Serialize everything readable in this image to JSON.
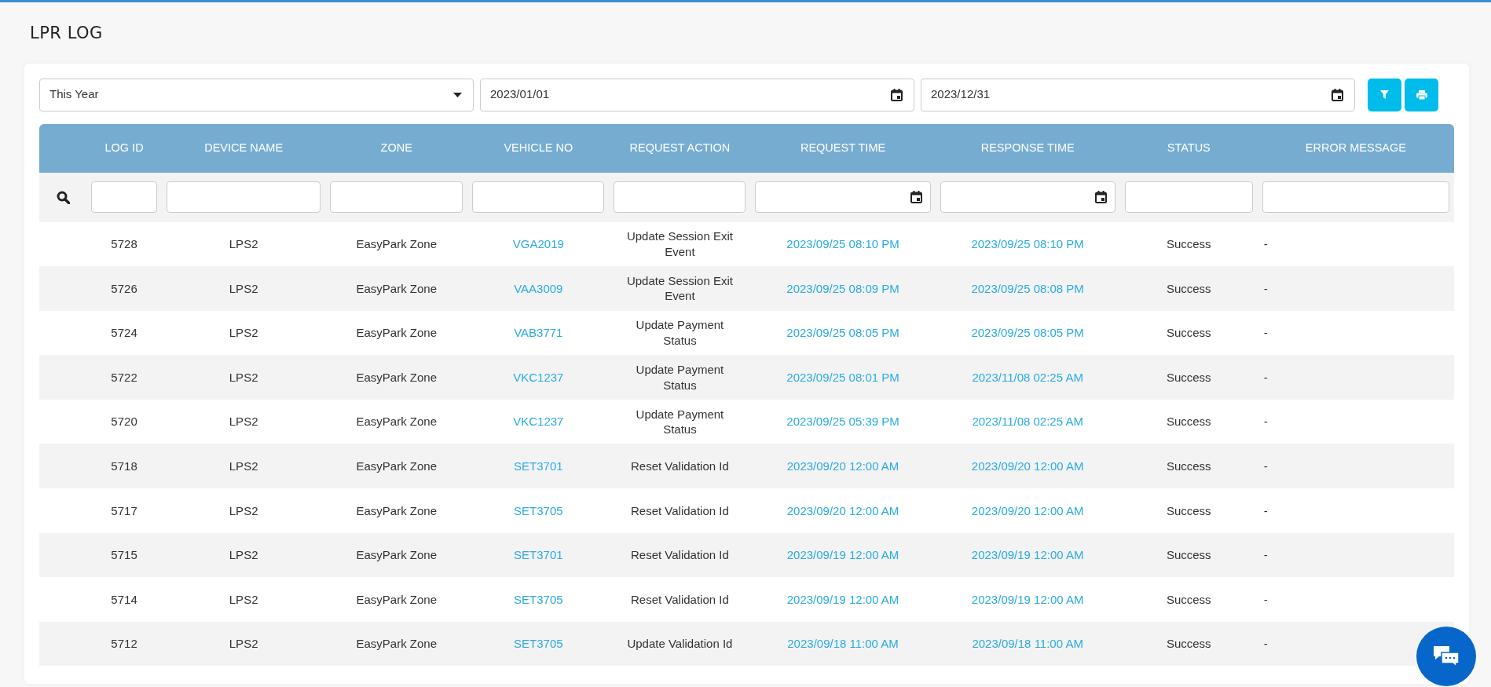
{
  "page_title": "LPR LOG",
  "filters": {
    "period": "This Year",
    "start_date": "2023/01/01",
    "end_date": "2023/12/31"
  },
  "table": {
    "columns": [
      "LOG ID",
      "DEVICE NAME",
      "ZONE",
      "VEHICLE NO",
      "REQUEST ACTION",
      "REQUEST TIME",
      "RESPONSE TIME",
      "STATUS",
      "ERROR MESSAGE"
    ],
    "filters": [
      {
        "kind": "text"
      },
      {
        "kind": "text"
      },
      {
        "kind": "text"
      },
      {
        "kind": "text"
      },
      {
        "kind": "text"
      },
      {
        "kind": "date"
      },
      {
        "kind": "date"
      },
      {
        "kind": "text"
      },
      {
        "kind": "text"
      }
    ],
    "rows": [
      {
        "log_id": "5728",
        "device": "LPS2",
        "zone": "EasyPark Zone",
        "vehicle": "VGA2019",
        "action": "Update Session Exit Event",
        "request_time": "2023/09/25 08:10 PM",
        "response_time": "2023/09/25 08:10 PM",
        "status": "Success",
        "error": "-"
      },
      {
        "log_id": "5726",
        "device": "LPS2",
        "zone": "EasyPark Zone",
        "vehicle": "VAA3009",
        "action": "Update Session Exit Event",
        "request_time": "2023/09/25 08:09 PM",
        "response_time": "2023/09/25 08:08 PM",
        "status": "Success",
        "error": "-"
      },
      {
        "log_id": "5724",
        "device": "LPS2",
        "zone": "EasyPark Zone",
        "vehicle": "VAB3771",
        "action": "Update Payment Status",
        "request_time": "2023/09/25 08:05 PM",
        "response_time": "2023/09/25 08:05 PM",
        "status": "Success",
        "error": "-"
      },
      {
        "log_id": "5722",
        "device": "LPS2",
        "zone": "EasyPark Zone",
        "vehicle": "VKC1237",
        "action": "Update Payment Status",
        "request_time": "2023/09/25 08:01 PM",
        "response_time": "2023/11/08 02:25 AM",
        "status": "Success",
        "error": "-"
      },
      {
        "log_id": "5720",
        "device": "LPS2",
        "zone": "EasyPark Zone",
        "vehicle": "VKC1237",
        "action": "Update Payment Status",
        "request_time": "2023/09/25 05:39 PM",
        "response_time": "2023/11/08 02:25 AM",
        "status": "Success",
        "error": "-"
      },
      {
        "log_id": "5718",
        "device": "LPS2",
        "zone": "EasyPark Zone",
        "vehicle": "SET3701",
        "action": "Reset Validation Id",
        "request_time": "2023/09/20 12:00 AM",
        "response_time": "2023/09/20 12:00 AM",
        "status": "Success",
        "error": "-"
      },
      {
        "log_id": "5717",
        "device": "LPS2",
        "zone": "EasyPark Zone",
        "vehicle": "SET3705",
        "action": "Reset Validation Id",
        "request_time": "2023/09/20 12:00 AM",
        "response_time": "2023/09/20 12:00 AM",
        "status": "Success",
        "error": "-"
      },
      {
        "log_id": "5715",
        "device": "LPS2",
        "zone": "EasyPark Zone",
        "vehicle": "SET3701",
        "action": "Reset Validation Id",
        "request_time": "2023/09/19 12:00 AM",
        "response_time": "2023/09/19 12:00 AM",
        "status": "Success",
        "error": "-"
      },
      {
        "log_id": "5714",
        "device": "LPS2",
        "zone": "EasyPark Zone",
        "vehicle": "SET3705",
        "action": "Reset Validation Id",
        "request_time": "2023/09/19 12:00 AM",
        "response_time": "2023/09/19 12:00 AM",
        "status": "Success",
        "error": "-"
      },
      {
        "log_id": "5712",
        "device": "LPS2",
        "zone": "EasyPark Zone",
        "vehicle": "SET3705",
        "action": "Update Validation Id",
        "request_time": "2023/09/18 11:00 AM",
        "response_time": "2023/09/18 11:00 AM",
        "status": "Success",
        "error": "-"
      }
    ]
  }
}
